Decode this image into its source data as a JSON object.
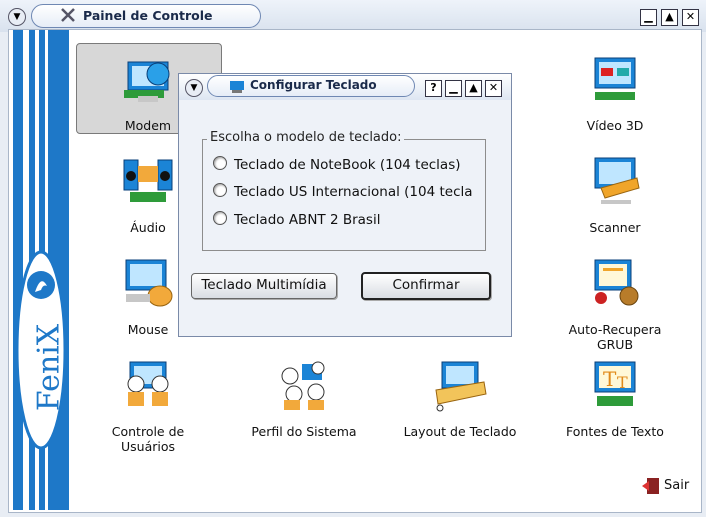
{
  "window": {
    "title": "Painel de Controle"
  },
  "sidebar": {
    "brand": "FeniX"
  },
  "icons": [
    {
      "label": "Modem",
      "icon": "modem-icon"
    },
    {
      "label": "Vídeo 3D",
      "icon": "video-3d-icon"
    },
    {
      "label": "Áudio",
      "icon": "audio-icon"
    },
    {
      "label": "Scanner",
      "icon": "scanner-icon"
    },
    {
      "label": "Mouse",
      "icon": "mouse-icon"
    },
    {
      "label": "Auto-Recupera GRUB",
      "icon": "grub-icon"
    },
    {
      "label": "Controle de Usuários",
      "icon": "users-icon"
    },
    {
      "label": "Perfil do Sistema",
      "icon": "system-profile-icon"
    },
    {
      "label": "Layout de Teclado",
      "icon": "keyboard-layout-icon"
    },
    {
      "label": "Fontes de Texto",
      "icon": "fonts-icon"
    }
  ],
  "exit": {
    "label": "Sair"
  },
  "dialog": {
    "title": "Configurar Teclado",
    "group_label": "Escolha o modelo de teclado:",
    "options": [
      {
        "label": "Teclado de NoteBook (104 teclas)",
        "selected": false
      },
      {
        "label": "Teclado US Internacional (104 tecla",
        "selected": false
      },
      {
        "label": "Teclado ABNT 2 Brasil",
        "selected": false
      }
    ],
    "multimedia_button": "Teclado Multimídia",
    "confirm_button": "Confirmar"
  }
}
